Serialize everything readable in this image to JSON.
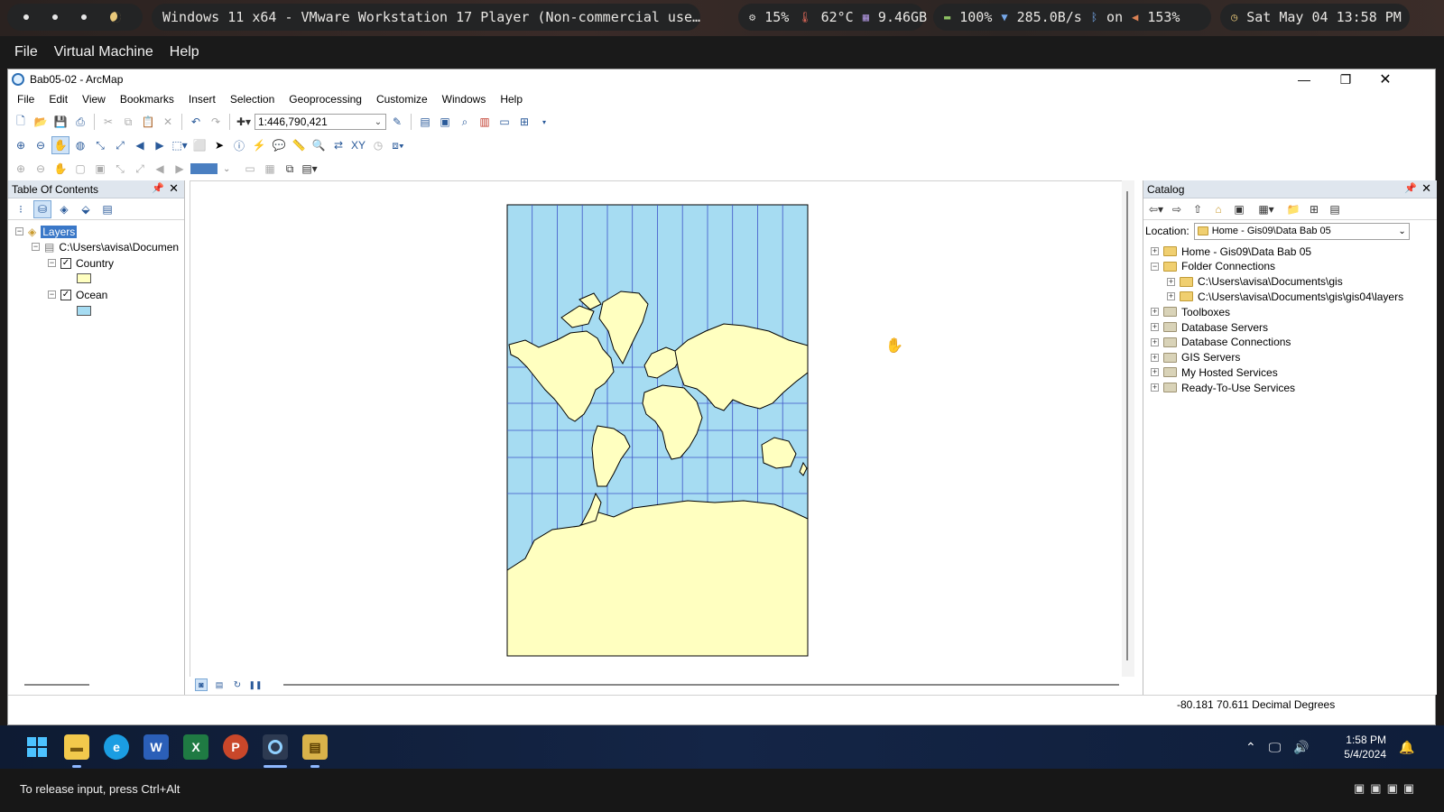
{
  "host": {
    "workspace_dots": [
      "•",
      "•",
      "•"
    ],
    "window_title": "Windows 11 x64 - VMware Workstation 17 Player (Non-commercial use…",
    "cpu": "15%",
    "temp": "62°C",
    "mem": "9.46GB",
    "battery": "100%",
    "net": "285.0B/s",
    "bluetooth": "on",
    "volume": "153%",
    "datetime": "Sat May 04 13:58 PM"
  },
  "vmware_menu": [
    "File",
    "Virtual Machine",
    "Help"
  ],
  "arcmap": {
    "title": "Bab05-02 - ArcMap",
    "menu": [
      "File",
      "Edit",
      "View",
      "Bookmarks",
      "Insert",
      "Selection",
      "Geoprocessing",
      "Customize",
      "Windows",
      "Help"
    ],
    "scale": "1:446,790,421",
    "toc": {
      "title": "Table Of Contents",
      "root": "Layers",
      "source": "C:\\Users\\avisa\\Documen",
      "layers": [
        {
          "name": "Country",
          "checked": true,
          "color": "#ffffc0"
        },
        {
          "name": "Ocean",
          "checked": true,
          "color": "#a6dcf2"
        }
      ]
    },
    "catalog": {
      "title": "Catalog",
      "location_label": "Location:",
      "location_value": "Home - Gis09\\Data Bab 05",
      "items": [
        {
          "label": "Home - Gis09\\Data Bab 05",
          "level": 0,
          "exp": "+"
        },
        {
          "label": "Folder Connections",
          "level": 0,
          "exp": "−"
        },
        {
          "label": "C:\\Users\\avisa\\Documents\\gis",
          "level": 1,
          "exp": "+"
        },
        {
          "label": "C:\\Users\\avisa\\Documents\\gis\\gis04\\layers",
          "level": 1,
          "exp": "+"
        },
        {
          "label": "Toolboxes",
          "level": 0,
          "exp": "+"
        },
        {
          "label": "Database Servers",
          "level": 0,
          "exp": "+"
        },
        {
          "label": "Database Connections",
          "level": 0,
          "exp": "+"
        },
        {
          "label": "GIS Servers",
          "level": 0,
          "exp": "+"
        },
        {
          "label": "My Hosted Services",
          "level": 0,
          "exp": "+"
        },
        {
          "label": "Ready-To-Use Services",
          "level": 0,
          "exp": "+"
        }
      ]
    },
    "status": {
      "coords": "-80.181  70.611 Decimal Degrees"
    },
    "colors": {
      "ocean": "#a6dcf2",
      "land": "#ffffc0",
      "graticule": "#3e54c8"
    }
  },
  "taskbar": {
    "apps": [
      "start-icon",
      "file-explorer-icon",
      "edge-icon",
      "word-icon",
      "excel-icon",
      "powerpoint-icon",
      "arcmap-icon",
      "arccatalog-icon"
    ],
    "time": "1:58 PM",
    "date": "5/4/2024"
  },
  "vm_notice": "To release input, press Ctrl+Alt"
}
